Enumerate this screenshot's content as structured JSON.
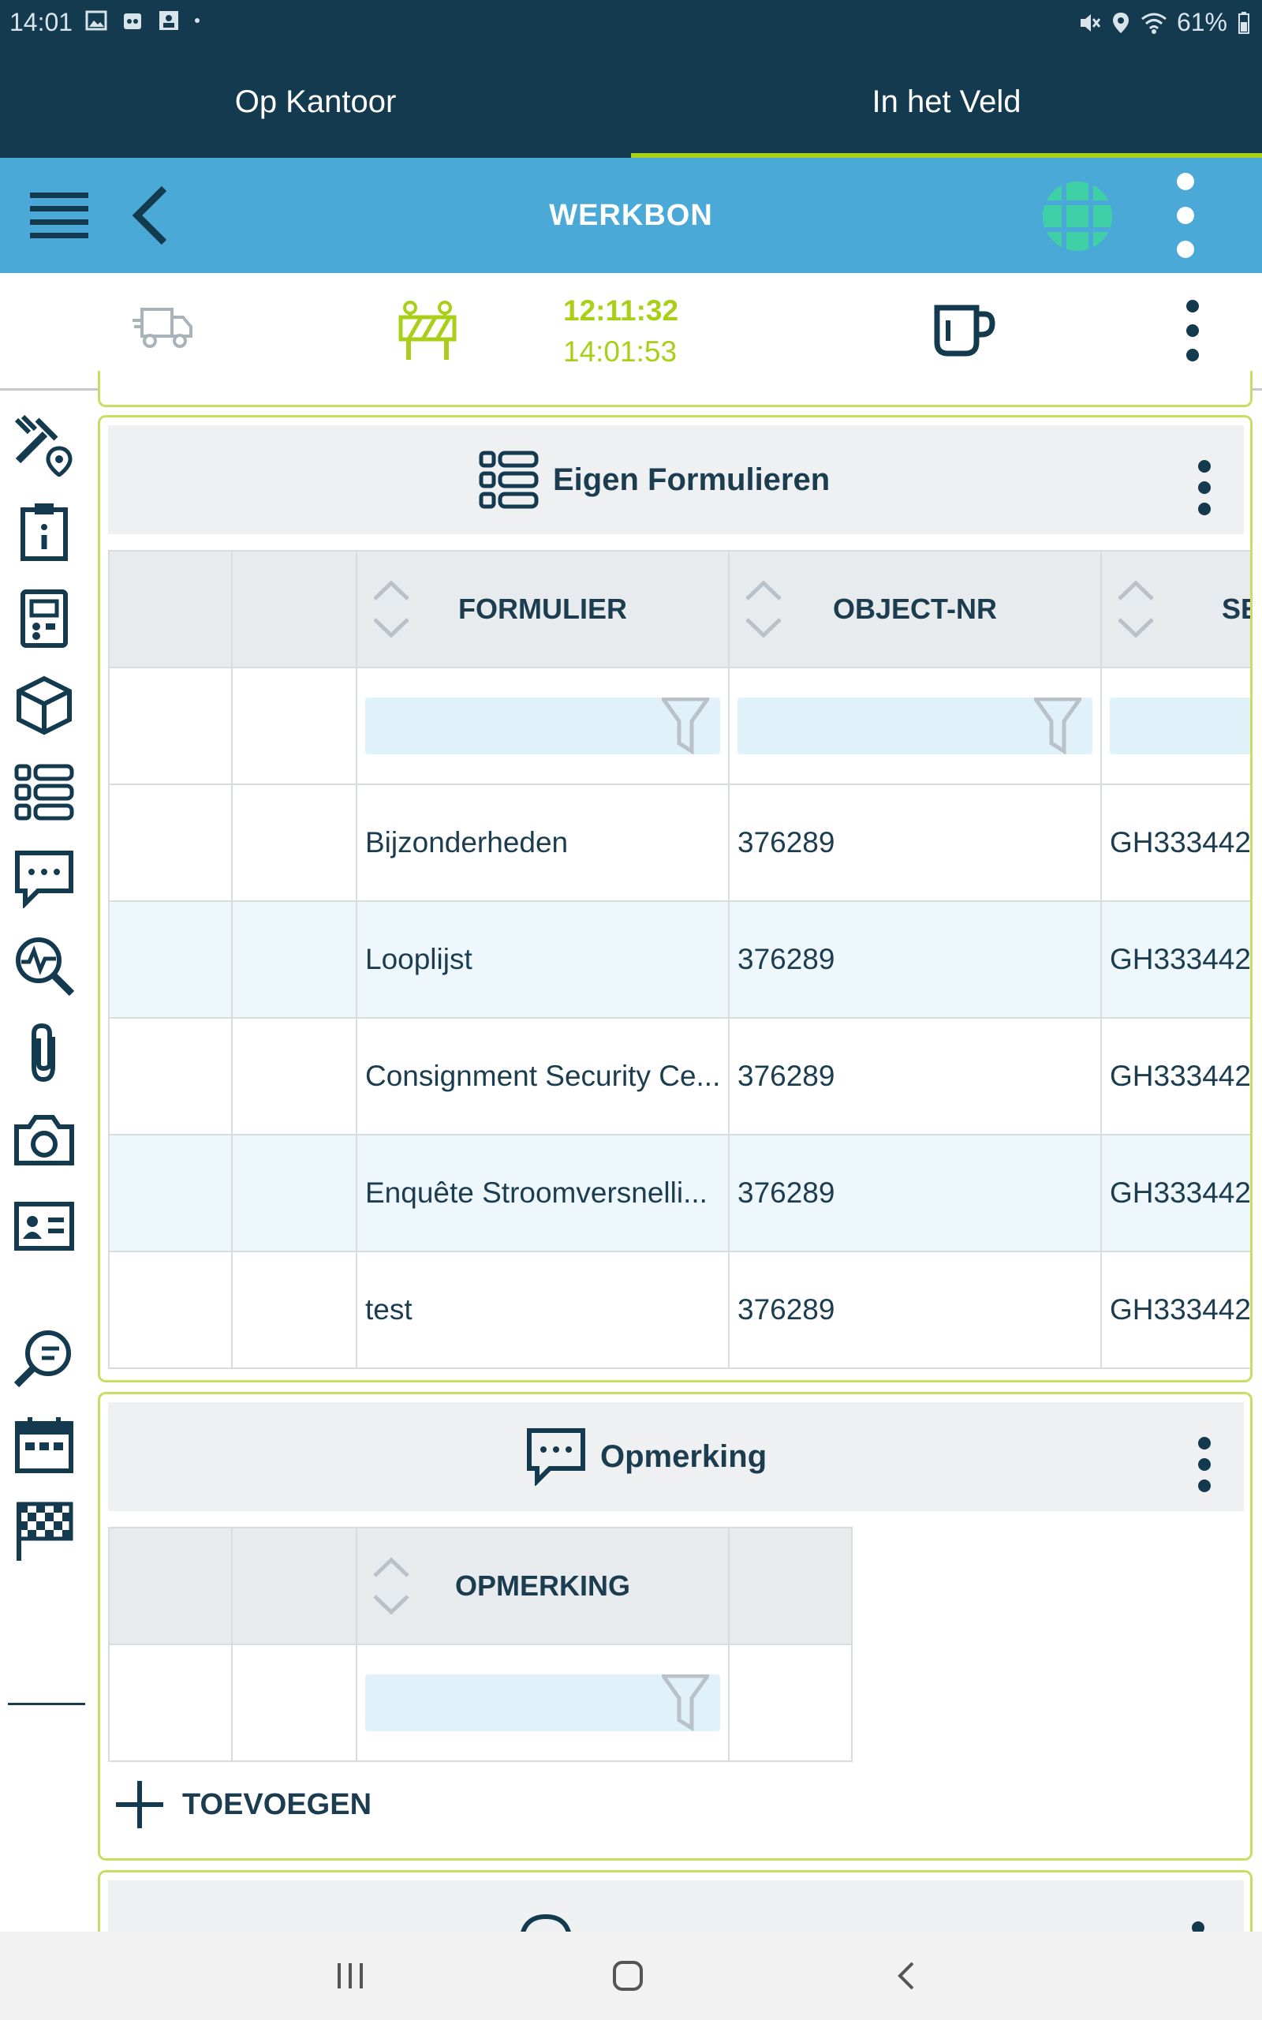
{
  "status_bar": {
    "time": "14:01",
    "battery": "61%"
  },
  "tabs": [
    {
      "label": "Op Kantoor",
      "active": false
    },
    {
      "label": "In het Veld",
      "active": true
    }
  ],
  "appbar": {
    "title": "WERKBON"
  },
  "toolbar": {
    "time_start": "12:11:32",
    "time_end": "14:01:53"
  },
  "colors": {
    "dark": "#143a50",
    "appbar": "#4aa9d7",
    "accent": "#a9cf19",
    "text": "#1c3d50",
    "globe": "#3fd0a8"
  },
  "forms_card": {
    "title": "Eigen Formulieren",
    "columns": [
      "FORMULIER",
      "OBJECT-NR",
      "SE"
    ],
    "rows": [
      {
        "formulier": "Bijzonderheden",
        "object_nr": "376289",
        "se": "GH333442"
      },
      {
        "formulier": "Looplijst",
        "object_nr": "376289",
        "se": "GH333442"
      },
      {
        "formulier": "Consignment Security Ce...",
        "object_nr": "376289",
        "se": "GH333442"
      },
      {
        "formulier": "Enquête Stroomversnelli...",
        "object_nr": "376289",
        "se": "GH333442"
      },
      {
        "formulier": "test",
        "object_nr": "376289",
        "se": "GH333442"
      }
    ]
  },
  "remark_card": {
    "title": "Opmerking",
    "columns": [
      "OPMERKING"
    ],
    "add_label": "TOEVOEGEN"
  }
}
